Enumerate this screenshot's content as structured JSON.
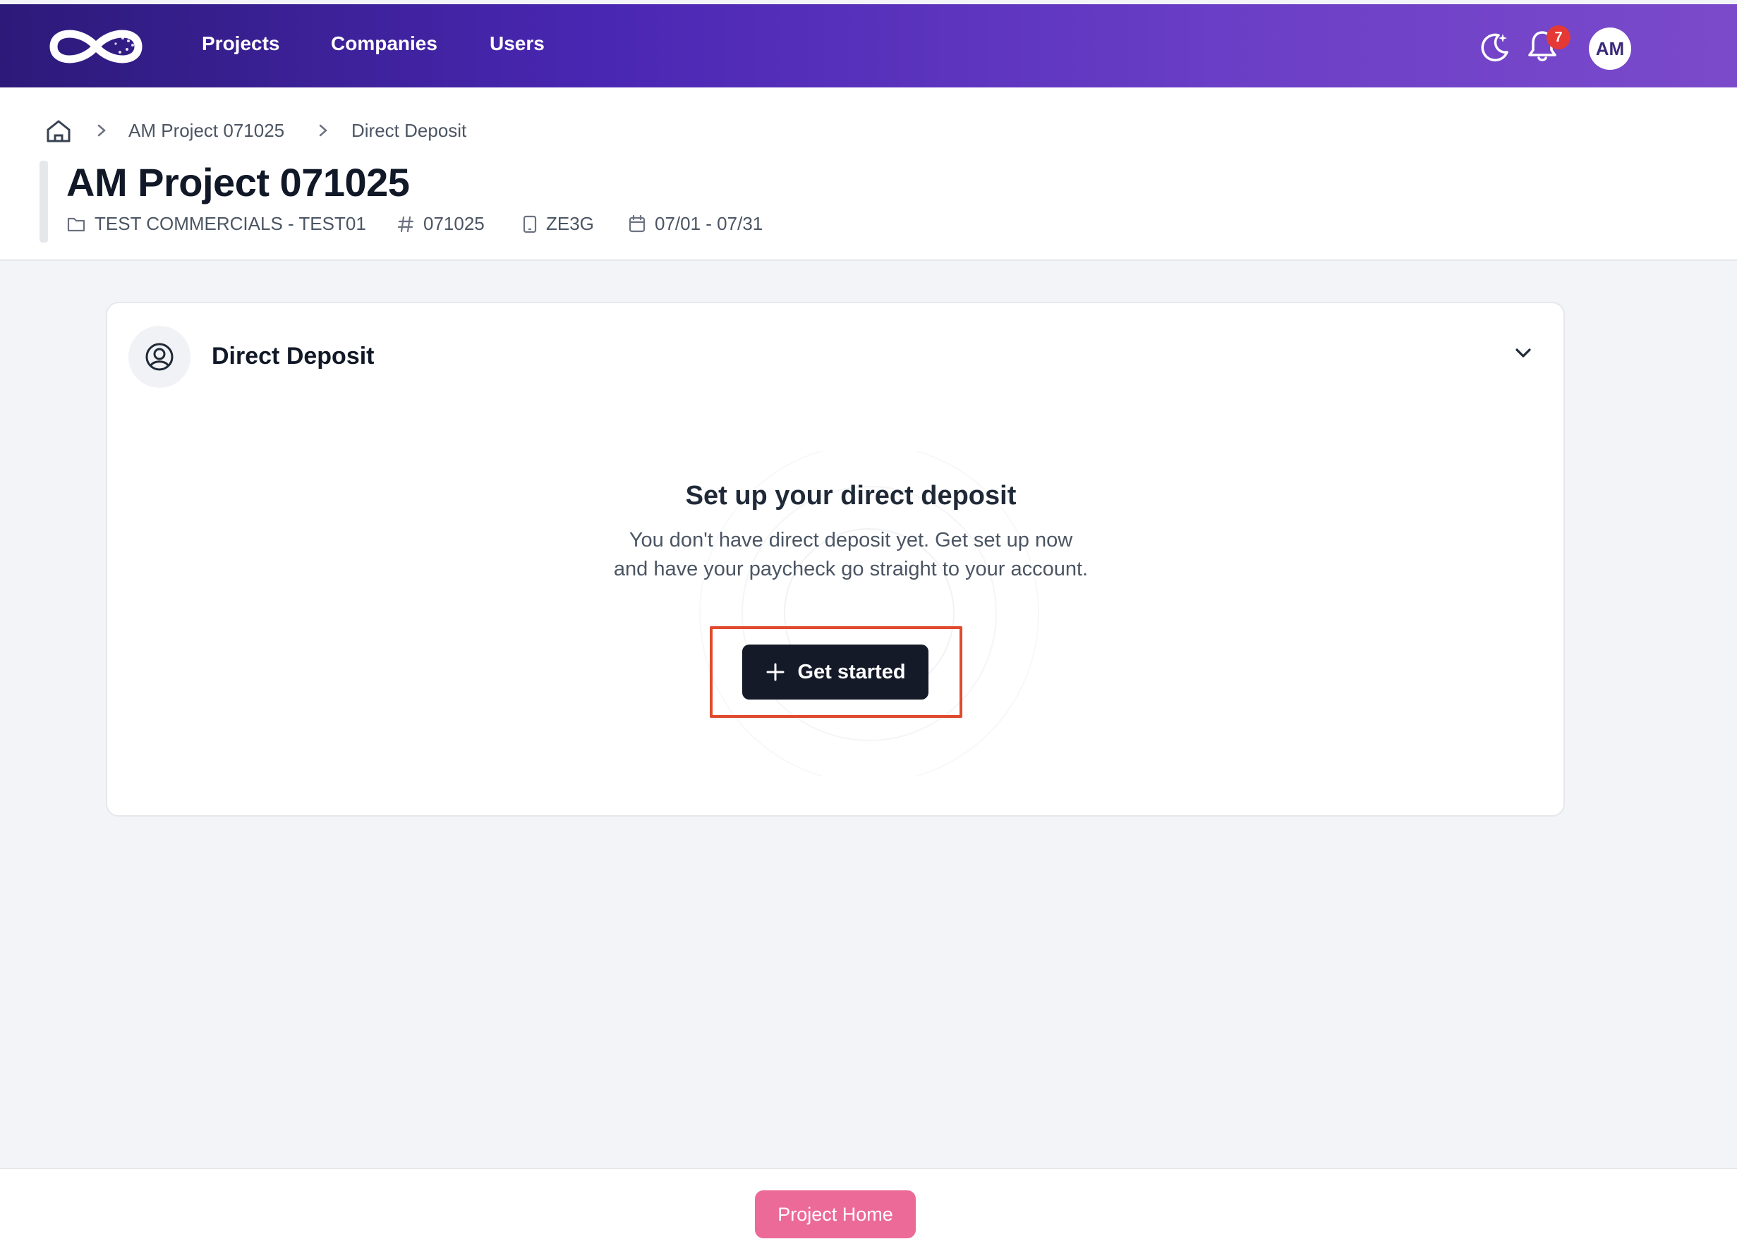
{
  "nav": {
    "logo_icon": "infinity-logo-icon",
    "links": [
      {
        "label": "Projects"
      },
      {
        "label": "Companies"
      },
      {
        "label": "Users"
      }
    ],
    "theme_icon": "moon-sparkle-icon",
    "bell_icon": "bell-icon",
    "notification_count": "7",
    "avatar_initials": "AM",
    "gradient_colors": [
      "#2c1a79",
      "#7b4acb"
    ]
  },
  "breadcrumb": {
    "home_icon": "home-icon",
    "items": [
      "AM Project 071025",
      "Direct Deposit"
    ]
  },
  "project": {
    "title": "AM Project 071025",
    "company": "TEST COMMERCIALS - TEST01",
    "number": "071025",
    "code": "ZE3G",
    "dates": "07/01 - 07/31",
    "company_icon": "folder-icon",
    "number_icon": "hash-icon",
    "code_icon": "device-icon",
    "dates_icon": "calendar-icon"
  },
  "card": {
    "title": "Direct Deposit",
    "header_icon": "user-circle-icon",
    "toggle_icon": "chevron-down-icon",
    "empty_title": "Set up your direct deposit",
    "empty_description": "You don't have direct deposit yet. Get set up now and have your paycheck go straight to your account.",
    "cta_label": "Get started",
    "cta_icon": "plus-icon",
    "highlight_color": "#e04a2f"
  },
  "footer": {
    "button_label": "Project Home",
    "button_color": "#ec6a98"
  }
}
